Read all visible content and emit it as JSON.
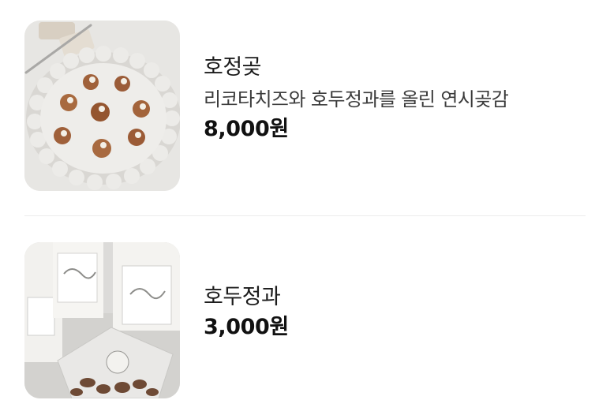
{
  "products": [
    {
      "name": "호정곶",
      "description": "리코타치즈와 호두정과를 올린 연시곶감",
      "price": "8,000원",
      "image_icon": "dessert-plate-photo"
    },
    {
      "name": "호두정과",
      "price": "3,000원",
      "image_icon": "packaged-walnut-photo"
    }
  ]
}
